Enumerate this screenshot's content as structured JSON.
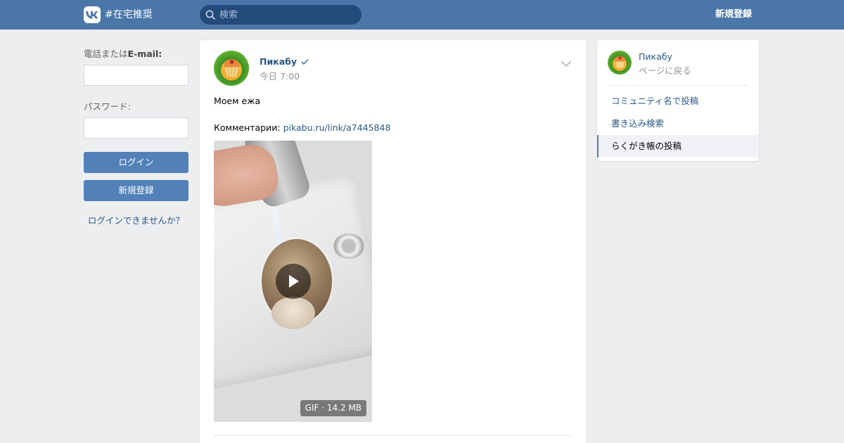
{
  "header": {
    "hashtag": "#在宅推奨",
    "search_placeholder": "検索",
    "register_label": "新規登録"
  },
  "login": {
    "email_label_prefix": "電話または",
    "email_label_bold": "E-mail:",
    "password_label": "パスワード:",
    "login_button": "ログイン",
    "register_button": "新規登録",
    "forgot_link": "ログインできませんか？"
  },
  "post": {
    "author": "Пикабу",
    "time": "今日 7:00",
    "text": "Моем ежа",
    "comment_prefix": "Комментарии: ",
    "comment_link": "pikabu.ru/link/a7445848",
    "media_badge": "GIF · 14.2 MB"
  },
  "sidebar": {
    "name": "Пикабу",
    "back": "ページに戻る",
    "items": [
      {
        "label": "コミュニティ名で投稿",
        "active": false
      },
      {
        "label": "書き込み検索",
        "active": false
      },
      {
        "label": "らくがき帳の投稿",
        "active": true
      }
    ]
  },
  "colors": {
    "header_bg": "#4a76a8",
    "page_bg": "#edeef0",
    "link": "#2a5885",
    "button": "#5181b8"
  },
  "icons": [
    "vk-logo-icon",
    "search-icon",
    "verified-icon",
    "chevron-down-icon",
    "play-icon"
  ]
}
